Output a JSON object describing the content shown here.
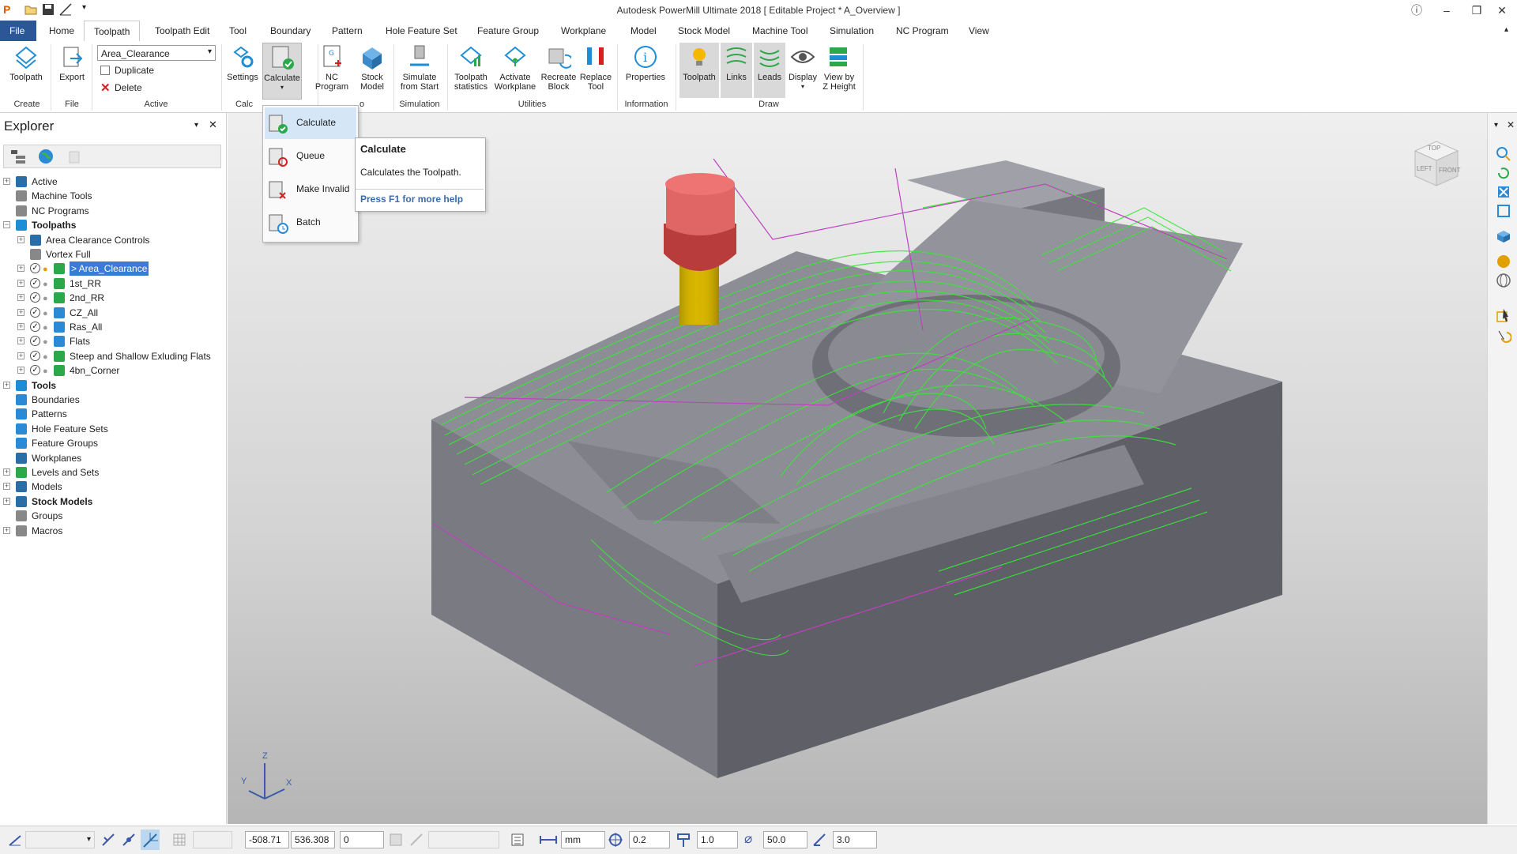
{
  "app": {
    "title": "Autodesk PowerMill Ultimate 2018    [ Editable Project * A_Overview ]"
  },
  "tabs": [
    "File",
    "Home",
    "Toolpath",
    "Toolpath Edit",
    "Tool",
    "Boundary",
    "Pattern",
    "Hole Feature Set",
    "Feature Group",
    "Workplane",
    "Model",
    "Stock Model",
    "Machine Tool",
    "Simulation",
    "NC Program",
    "View"
  ],
  "ribbon": {
    "create": {
      "toolpath": "Toolpath",
      "group": "Create"
    },
    "file": {
      "export": "Export",
      "group": "File"
    },
    "active": {
      "selected": "Area_Clearance",
      "duplicate": "Duplicate",
      "delete": "Delete",
      "group": "Active"
    },
    "calc": {
      "settings": "Settings",
      "calculate": "Calculate",
      "group": "Calc"
    },
    "nc": {
      "nc_program_1": "NC",
      "nc_program_2": "Program",
      "group_tail": "o"
    },
    "stock": {
      "stock_1": "Stock",
      "stock_2": "Model"
    },
    "simulation": {
      "sim_1": "Simulate",
      "sim_2": "from Start",
      "group": "Simulation"
    },
    "utilities": {
      "stats_1": "Toolpath",
      "stats_2": "statistics",
      "activate_1": "Activate",
      "activate_2": "Workplane",
      "recreate_1": "Recreate",
      "recreate_2": "Block",
      "replace_1": "Replace",
      "replace_2": "Tool",
      "group": "Utilities"
    },
    "information": {
      "properties": "Properties",
      "group": "Information"
    },
    "draw": {
      "toolpath": "Toolpath",
      "links": "Links",
      "leads": "Leads",
      "display": "Display",
      "view_1": "View by",
      "view_2": "Z Height",
      "group": "Draw"
    }
  },
  "calc_menu": {
    "items": [
      "Calculate",
      "Queue",
      "Make Invalid",
      "Batch"
    ]
  },
  "tooltip": {
    "title": "Calculate",
    "body": "Calculates the Toolpath.",
    "help": "Press F1 for more help"
  },
  "explorer": {
    "title": "Explorer",
    "tree": [
      {
        "label": "Active",
        "bold": false
      },
      {
        "label": "Machine Tools",
        "bold": false
      },
      {
        "label": "NC Programs",
        "bold": false
      },
      {
        "label": "Toolpaths",
        "bold": true
      },
      {
        "label": "Area Clearance Controls",
        "bold": false
      },
      {
        "label": "Vortex Full",
        "bold": false
      },
      {
        "label": "> Area_Clearance",
        "bold": false
      },
      {
        "label": "1st_RR",
        "bold": false
      },
      {
        "label": "2nd_RR",
        "bold": false
      },
      {
        "label": "CZ_All",
        "bold": false
      },
      {
        "label": "Ras_All",
        "bold": false
      },
      {
        "label": "Flats",
        "bold": false
      },
      {
        "label": "Steep and Shallow Exluding Flats",
        "bold": false
      },
      {
        "label": "4bn_Corner",
        "bold": false
      },
      {
        "label": "Tools",
        "bold": true
      },
      {
        "label": "Boundaries",
        "bold": false
      },
      {
        "label": "Patterns",
        "bold": false
      },
      {
        "label": "Hole Feature Sets",
        "bold": false
      },
      {
        "label": "Feature Groups",
        "bold": false
      },
      {
        "label": "Workplanes",
        "bold": false
      },
      {
        "label": "Levels and Sets",
        "bold": false
      },
      {
        "label": "Models",
        "bold": false
      },
      {
        "label": "Stock Models",
        "bold": true
      },
      {
        "label": "Groups",
        "bold": false
      },
      {
        "label": "Macros",
        "bold": false
      }
    ]
  },
  "viewcube": {
    "top": "TOP",
    "front": "FRONT",
    "left": "LEFT"
  },
  "axes": {
    "x": "X",
    "y": "Y",
    "z": "Z"
  },
  "status": {
    "x": "-508.71",
    "y": "536.308",
    "z": "0",
    "units": "mm",
    "tolerance": "0.2",
    "thickness": "1.0",
    "diameter": "50.0",
    "step": "3.0"
  },
  "colors": {
    "accent": "#2b5797",
    "toolpath": "#39e639",
    "link": "#c040c0",
    "tool_holder": "#e06666",
    "tool_shank": "#d4b400",
    "block": "#6e6e76"
  }
}
